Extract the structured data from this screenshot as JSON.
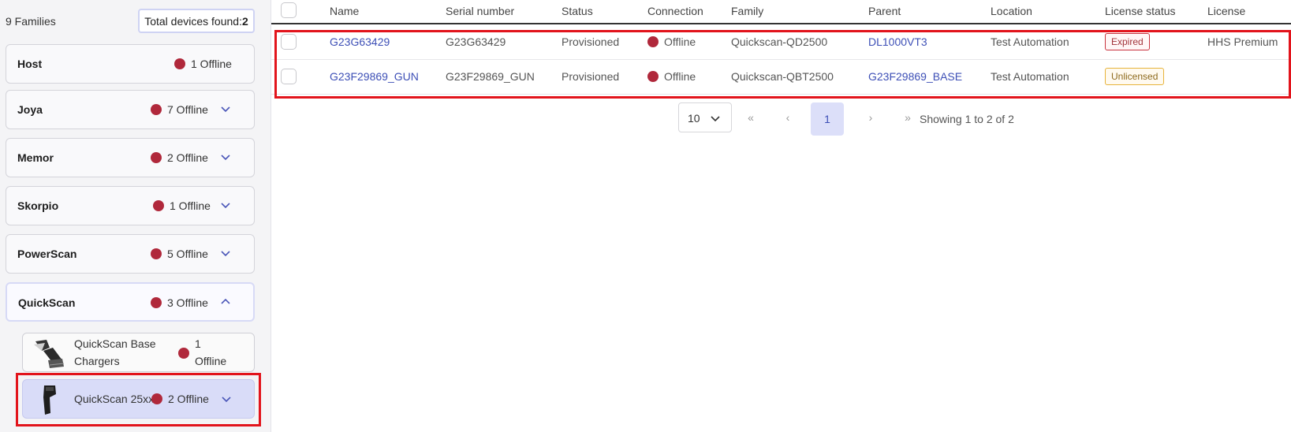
{
  "sidebar": {
    "families_count": "9 Families",
    "total_label": "Total devices found:",
    "total_value": "2",
    "families": [
      {
        "name": "Host",
        "offline": "1 Offline"
      },
      {
        "name": "Joya",
        "offline": "7 Offline"
      },
      {
        "name": "Memor",
        "offline": "2 Offline"
      },
      {
        "name": "Skorpio",
        "offline": "1 Offline"
      },
      {
        "name": "PowerScan",
        "offline": "5 Offline"
      },
      {
        "name": "QuickScan",
        "offline": "3 Offline"
      }
    ],
    "subfamilies": [
      {
        "name_line1": "QuickScan Base",
        "name_line2": "Chargers",
        "offline_line1": "1",
        "offline_line2": "Offline"
      },
      {
        "name": "QuickScan 25xx",
        "offline": "2 Offline"
      }
    ]
  },
  "table": {
    "headers": [
      "Name",
      "Serial number",
      "Status",
      "Connection",
      "Family",
      "Parent",
      "Location",
      "License status",
      "License"
    ],
    "rows": [
      {
        "name": "G23G63429",
        "serial": "G23G63429",
        "status": "Provisioned",
        "connection": "Offline",
        "family": "Quickscan-QD2500",
        "parent": "DL1000VT3",
        "location": "Test Automation",
        "license_status": "Expired",
        "license": "HHS Premium"
      },
      {
        "name": "G23F29869_GUN",
        "serial": "G23F29869_GUN",
        "status": "Provisioned",
        "connection": "Offline",
        "family": "Quickscan-QBT2500",
        "parent": "G23F29869_BASE",
        "location": "Test Automation",
        "license_status": "Unlicensed",
        "license": ""
      }
    ]
  },
  "pagination": {
    "page_size": "10",
    "first": "«",
    "prev": "‹",
    "current": "1",
    "next": "›",
    "last": "»",
    "info": "Showing 1 to 2 of 2"
  },
  "icons": {
    "status_dot": "offline-status-dot",
    "expand": "chevron-down-icon",
    "collapse": "chevron-up-icon"
  },
  "colors": {
    "offline": "#b0283b",
    "link": "#3d4fb6",
    "selected": "#d9dcf8",
    "highlight": "#e2141c",
    "expired": "#c9343f",
    "unlicensed": "#e7b33a"
  }
}
